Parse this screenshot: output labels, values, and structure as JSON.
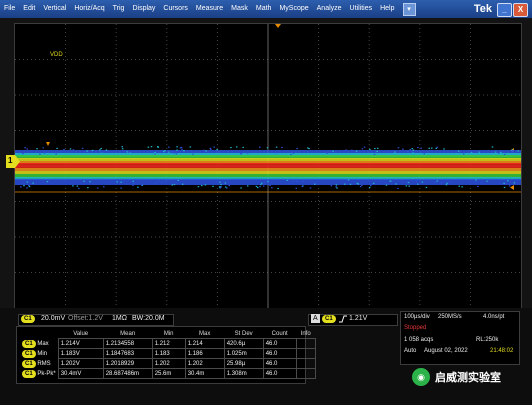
{
  "menu": [
    "File",
    "Edit",
    "Vertical",
    "Horiz/Acq",
    "Trig",
    "Display",
    "Cursors",
    "Measure",
    "Mask",
    "Math",
    "MyScope",
    "Analyze",
    "Utilities",
    "Help"
  ],
  "brand": "Tek",
  "window_buttons": {
    "minimize": "_",
    "close": "X"
  },
  "waveform": {
    "label": "VDD",
    "marker": "1"
  },
  "channel_settings": {
    "channel": "C1",
    "scale": "20.0mV",
    "offset": "Offset:1.2V",
    "impedance": "1MΩ",
    "bandwidth": "BW:20.0M"
  },
  "trigger": {
    "mode_badge": "A",
    "channel": "C1",
    "slope_icon": "rising-edge",
    "level": "1.21V"
  },
  "acquisition": {
    "time_per_div": "100µs/div",
    "sample_rate": "250MS/s",
    "sample_interval": "4.0ns/pt",
    "state": "Stopped",
    "acqs": "1 058 acqs",
    "record_length": "RL:250k",
    "mode": "Auto",
    "date": "August 02, 2022",
    "time": "21:48:02"
  },
  "measurements": {
    "headers": [
      "",
      "Value",
      "Mean",
      "Min",
      "Max",
      "St Dev",
      "Count",
      "Info"
    ],
    "rows": [
      {
        "ch": "C1",
        "name": "Max",
        "value": "1.214V",
        "mean": "1.2134558",
        "min": "1.212",
        "max": "1.214",
        "stdev": "420.6µ",
        "count": "46.0",
        "info": ""
      },
      {
        "ch": "C1",
        "name": "Min",
        "value": "1.183V",
        "mean": "1.1847683",
        "min": "1.183",
        "max": "1.186",
        "stdev": "1.025m",
        "count": "46.0",
        "info": ""
      },
      {
        "ch": "C1",
        "name": "RMS",
        "value": "1.202V",
        "mean": "1.2018929",
        "min": "1.202",
        "max": "1.202",
        "stdev": "25.98µ",
        "count": "46.0",
        "info": ""
      },
      {
        "ch": "C1",
        "name": "Pk-Pk*",
        "value": "30.4mV",
        "mean": "28.687486m",
        "min": "25.6m",
        "max": "30.4m",
        "stdev": "1.308m",
        "count": "46.0",
        "info": ""
      }
    ]
  },
  "watermark": "启威测实验室",
  "colors": {
    "channel": "#e3df1f",
    "menu": "#1b3f86",
    "cursor": "#e68a00",
    "stopped": "#e53935",
    "time": "#e3df1f"
  }
}
